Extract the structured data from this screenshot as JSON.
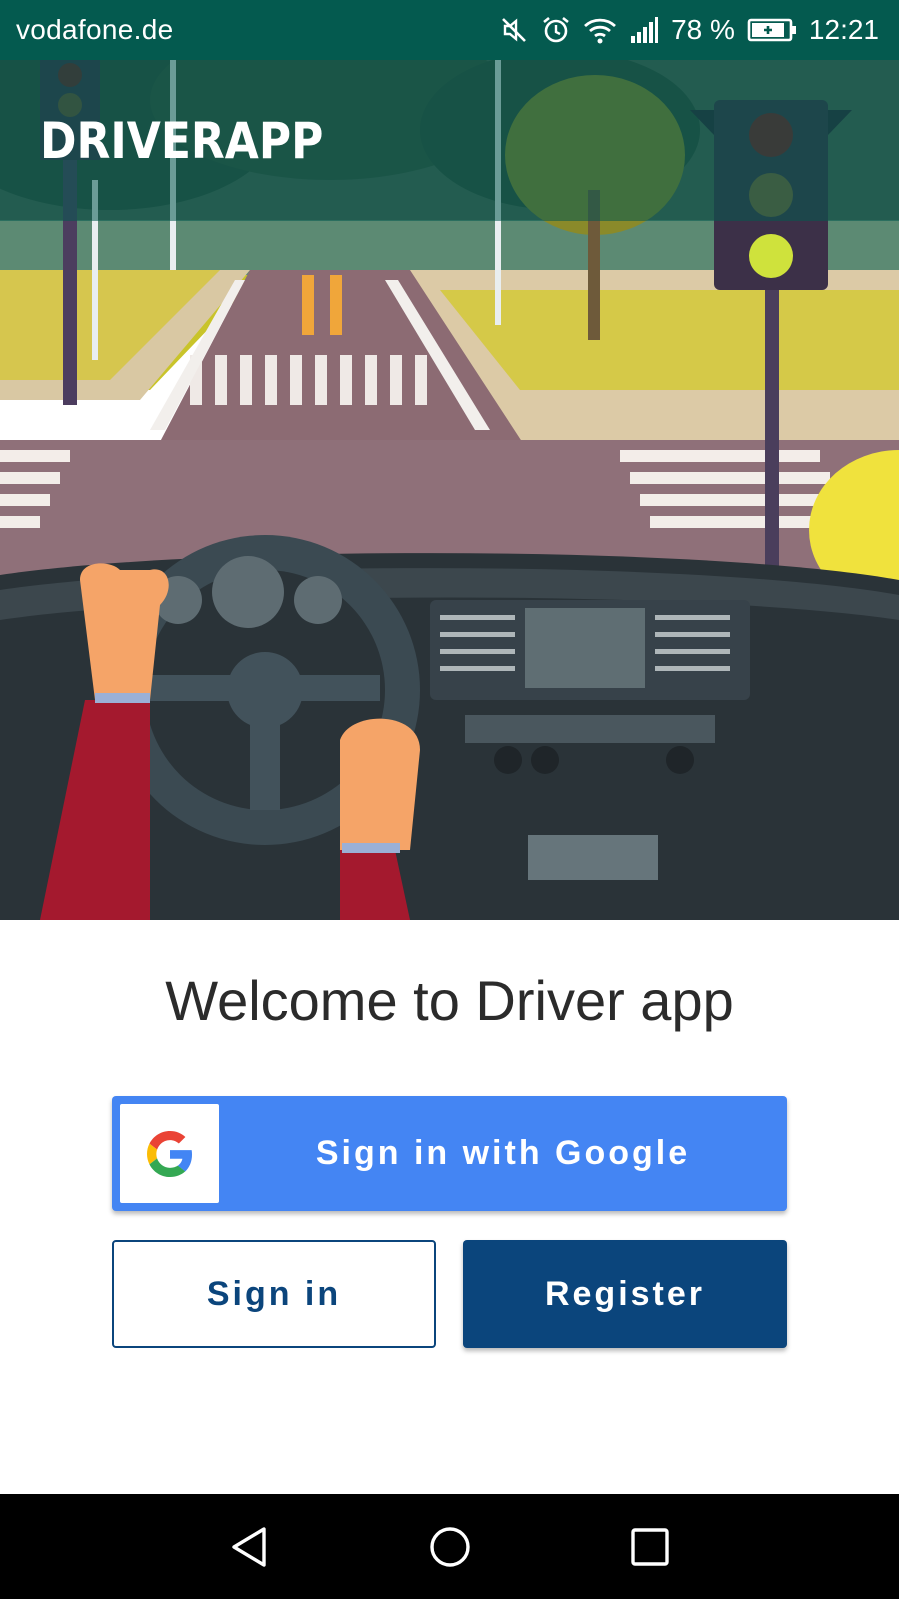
{
  "status_bar": {
    "carrier": "vodafone.de",
    "battery": "78 %",
    "time": "12:21",
    "icons": [
      "mute-icon",
      "alarm-icon",
      "wifi-icon",
      "signal-icon",
      "battery-charging-icon"
    ]
  },
  "app_bar": {
    "title": "DRIVERAPP"
  },
  "hero": {
    "illustration": "driver-at-crossroads"
  },
  "welcome": {
    "heading": "Welcome to Driver app"
  },
  "buttons": {
    "google_label": "Sign in with Google",
    "signin_label": "Sign in",
    "register_label": "Register"
  },
  "nav": {
    "icons": [
      "back-icon",
      "home-icon",
      "recents-icon"
    ]
  },
  "colors": {
    "status_bar": "#045a4f",
    "google_blue": "#4485f3",
    "primary_navy": "#0b457c",
    "heading_text": "#2b2b2b"
  }
}
